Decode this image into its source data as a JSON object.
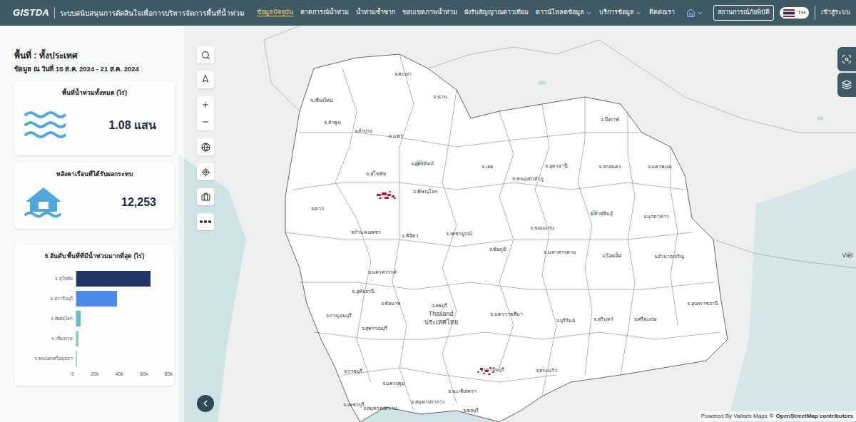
{
  "header": {
    "logo": "GISTDA",
    "title": "ระบบสนับสนุนการตัดสินใจเพื่อการบริหารจัดการพื้นที่น้ำท่วม",
    "nav": [
      {
        "label": "ข้อมูลปัจจุบัน",
        "selected": true,
        "dropdown": false
      },
      {
        "label": "คาดการณ์น้ำท่วม",
        "selected": false,
        "dropdown": false
      },
      {
        "label": "น้ำท่วมซ้ำซาก",
        "selected": false,
        "dropdown": false
      },
      {
        "label": "ขอบเขตภาพน้ำท่วม",
        "selected": false,
        "dropdown": false
      },
      {
        "label": "ผังรับสัญญาณดาวเทียม",
        "selected": false,
        "dropdown": false
      },
      {
        "label": "ดาวน์โหลดข้อมูล",
        "selected": false,
        "dropdown": true
      },
      {
        "label": "บริการข้อมูล",
        "selected": false,
        "dropdown": true
      },
      {
        "label": "ติดต่อเรา",
        "selected": false,
        "dropdown": false
      }
    ],
    "disaster_button": "สถานการณ์ภัยพิบัติ",
    "language": "TH",
    "login": "เข้าสู่ระบบ"
  },
  "summary": {
    "area_label": "พื้นที่ : ทั้งประเทศ",
    "date_label": "ข้อมูล ณ วันที่ 15 ส.ค. 2024 - 21 ส.ค. 2024",
    "cards": [
      {
        "title": "พื้นที่น้ำท่วมทั้งหมด (ไร่)",
        "value": "1.08 แสน",
        "kind": "flood"
      },
      {
        "title": "หลังคาเรือนที่ได้รับผลกระทบ",
        "value": "12,253",
        "kind": "house"
      }
    ]
  },
  "chart": {
    "title": "5 อันดับ พื้นที่ที่มีน้ำท่วมมากที่สุด (ไร่)",
    "axis_max": 80000,
    "bars": [
      {
        "label": "จ.สุโขทัย",
        "value": 64000,
        "color": "#1f3566"
      },
      {
        "label": "จ.ปราจีนบุรี",
        "value": 35000,
        "color": "#4a8ae8"
      },
      {
        "label": "จ.พิษณุโลก",
        "value": 3500,
        "color": "#5cc3c6"
      },
      {
        "label": "จ.เชียงราย",
        "value": 2000,
        "color": "#7fd3cf"
      },
      {
        "label": "จ.พระนครศรีอยุธยา",
        "value": 900,
        "color": "#9fe0d8"
      }
    ],
    "ticks": [
      "0",
      "20k",
      "40k",
      "60k",
      "80k"
    ]
  },
  "map": {
    "labels": [
      "จ.พะเยา",
      "จ.น่าน",
      "จ.เชียงใหม่",
      "จ.ลำปาง",
      "จ.แพร่",
      "จ.ลำพูน",
      "จ.อุตรดิตถ์",
      "จ.สุโขทัย",
      "จ.พิษณุโลก",
      "จ.ตาก",
      "จ.เลย",
      "จ.หนองบัวลำภู",
      "จ.อุดรธานี",
      "จ.บึงกาฬ",
      "จ.สกลนคร",
      "จ.นครพนม",
      "จ.ขอนแก่น",
      "จ.กาฬสินธุ์",
      "จ.มุกดาหาร",
      "จ.กำแพงเพชร",
      "จ.พิจิตร",
      "จ.เพชรบูรณ์",
      "จ.ชัยภูมิ",
      "จ.มหาสารคาม",
      "จ.ร้อยเอ็ด",
      "จ.อำนาจเจริญ",
      "จ.นครสวรรค์",
      "จ.อุทัยธานี",
      "จ.ชัยนาท",
      "จ.ลพบุรี",
      "จ.นครราชสีมา",
      "จ.บุรีรัมย์",
      "จ.สุรินทร์",
      "จ.ศรีสะเกษ",
      "จ.อุบลราชธานี",
      "จ.กาญจนบุรี",
      "จ.สุพรรณบุรี",
      "จ.สระแก้ว",
      "จ.ปราจีนบุรี",
      "จ.ราชบุรี",
      "จ.นครปฐม",
      "จ.สมุทรปราการ",
      "จ.เพชรบุรี",
      "จ.ชลบุรี",
      "จ.สมุทรสงคราม",
      "จ.ฉะเชิงเทรา"
    ],
    "country_labels": [
      "Thailand",
      "ประเทศไทย",
      "Việt"
    ],
    "attribution_powered": "Powered By Vallaris Maps",
    "attribution_copy": "©",
    "attribution_osm": "OpenStreetMap contributors"
  }
}
